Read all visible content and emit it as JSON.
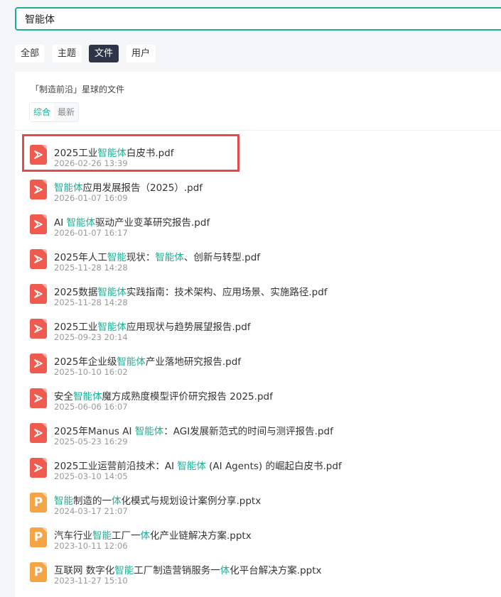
{
  "search": {
    "value": "智能体"
  },
  "tabs": [
    {
      "label": "全部",
      "active": false
    },
    {
      "label": "主题",
      "active": false
    },
    {
      "label": "文件",
      "active": true
    },
    {
      "label": "用户",
      "active": false
    }
  ],
  "panel": {
    "title": "「制造前沿」星球的文件",
    "sort": [
      {
        "label": "综合",
        "active": true
      },
      {
        "label": "最新",
        "active": false
      }
    ]
  },
  "colors": {
    "accent": "#1aaf95",
    "pdf": "#f05b4f",
    "pptx": "#f5a546",
    "highlight_box": "#df4c4d",
    "active_tab": "#2e3549"
  },
  "files": [
    {
      "type": "pdf",
      "icon": "pdf-file-icon",
      "highlighted": true,
      "name_parts": [
        [
          "2025工业",
          false
        ],
        [
          "智能体",
          true
        ],
        [
          "白皮书.pdf",
          false
        ]
      ],
      "date": "2026-02-26 13:39"
    },
    {
      "type": "pdf",
      "icon": "pdf-file-icon",
      "name_parts": [
        [
          "智能体",
          true
        ],
        [
          "应用发展报告（2025）.pdf",
          false
        ]
      ],
      "date": "2026-01-07 16:09"
    },
    {
      "type": "pdf",
      "icon": "pdf-file-icon",
      "name_parts": [
        [
          "AI ",
          false
        ],
        [
          "智能体",
          true
        ],
        [
          "驱动产业变革研究报告.pdf",
          false
        ]
      ],
      "date": "2026-01-07 16:17"
    },
    {
      "type": "pdf",
      "icon": "pdf-file-icon",
      "name_parts": [
        [
          "2025年人工",
          false
        ],
        [
          "智能",
          true
        ],
        [
          "现状：",
          false
        ],
        [
          "智能体",
          true
        ],
        [
          "、创新与转型.pdf",
          false
        ]
      ],
      "date": "2025-11-28 14:28"
    },
    {
      "type": "pdf",
      "icon": "pdf-file-icon",
      "name_parts": [
        [
          "2025数据",
          false
        ],
        [
          "智能体",
          true
        ],
        [
          "实践指南：技术架构、应用场景、实施路径.pdf",
          false
        ]
      ],
      "date": "2025-11-28 14:28"
    },
    {
      "type": "pdf",
      "icon": "pdf-file-icon",
      "name_parts": [
        [
          "2025工业",
          false
        ],
        [
          "智能体",
          true
        ],
        [
          "应用现状与趋势展望报告.pdf",
          false
        ]
      ],
      "date": "2025-09-23 20:14"
    },
    {
      "type": "pdf",
      "icon": "pdf-file-icon",
      "name_parts": [
        [
          "2025年企业级",
          false
        ],
        [
          "智能体",
          true
        ],
        [
          "产业落地研究报告.pdf",
          false
        ]
      ],
      "date": "2025-10-10 16:02"
    },
    {
      "type": "pdf",
      "icon": "pdf-file-icon",
      "name_parts": [
        [
          "安全",
          false
        ],
        [
          "智能体",
          true
        ],
        [
          "魔方成熟度模型评价研究报告 2025.pdf",
          false
        ]
      ],
      "date": "2025-06-06 16:07"
    },
    {
      "type": "pdf",
      "icon": "pdf-file-icon",
      "name_parts": [
        [
          "2025年Manus AI ",
          false
        ],
        [
          "智能体",
          true
        ],
        [
          "：AGI发展新范式的时间与测评报告.pdf",
          false
        ]
      ],
      "date": "2025-05-23 16:29"
    },
    {
      "type": "pdf",
      "icon": "pdf-file-icon",
      "name_parts": [
        [
          "2025工业运营前沿技术：AI ",
          false
        ],
        [
          "智能体",
          true
        ],
        [
          " (AI Agents) 的崛起白皮书.pdf",
          false
        ]
      ],
      "date": "2025-03-10 14:05"
    },
    {
      "type": "pptx",
      "icon": "pptx-file-icon",
      "name_parts": [
        [
          "智能",
          true
        ],
        [
          "制造的一",
          false
        ],
        [
          "体",
          true
        ],
        [
          "化模式与规划设计案例分享.pptx",
          false
        ]
      ],
      "date": "2024-03-17 21:07"
    },
    {
      "type": "pptx",
      "icon": "pptx-file-icon",
      "name_parts": [
        [
          "汽车行业",
          false
        ],
        [
          "智能",
          true
        ],
        [
          "工厂一",
          false
        ],
        [
          "体",
          true
        ],
        [
          "化产业链解决方案.pptx",
          false
        ]
      ],
      "date": "2023-10-11 12:06"
    },
    {
      "type": "pptx",
      "icon": "pptx-file-icon",
      "name_parts": [
        [
          "互联网 数字化",
          false
        ],
        [
          "智能",
          true
        ],
        [
          "工厂制造营销服务一",
          false
        ],
        [
          "体",
          true
        ],
        [
          "化平台解决方案.pptx",
          false
        ]
      ],
      "date": "2023-11-27 15:10"
    }
  ]
}
